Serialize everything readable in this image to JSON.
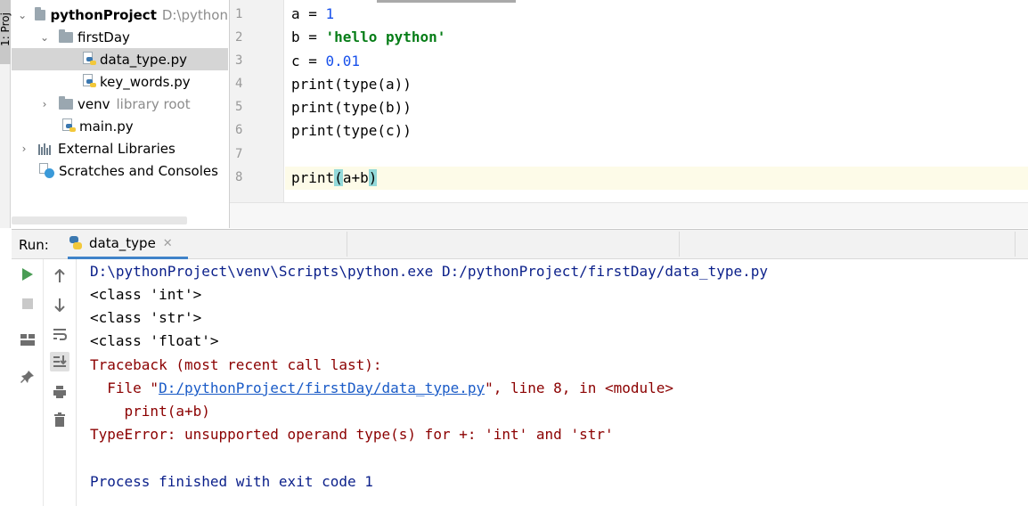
{
  "tool_strip": {
    "project_tab": "1: Proj"
  },
  "project_tree": {
    "root": {
      "name": "pythonProject",
      "path": "D:\\python"
    },
    "items": [
      {
        "label": "firstDay"
      },
      {
        "label": "data_type.py"
      },
      {
        "label": "key_words.py"
      },
      {
        "label": "venv",
        "suffix": "library root"
      },
      {
        "label": "main.py"
      },
      {
        "label": "External Libraries"
      },
      {
        "label": "Scratches and Consoles"
      }
    ]
  },
  "editor": {
    "line_numbers": [
      "1",
      "2",
      "3",
      "4",
      "5",
      "6",
      "7",
      "8"
    ],
    "lines": {
      "l1_var": "a = ",
      "l1_num": "1",
      "l2_var": "b = ",
      "l2_str": "'hello python'",
      "l3_var": "c = ",
      "l3_num": "0.01",
      "l4": "print(type(a))",
      "l5": "print(type(b))",
      "l6": "print(type(c))",
      "l8_a": "print",
      "l8_b": "(",
      "l8_c": "a+b",
      "l8_d": ")"
    }
  },
  "run": {
    "label": "Run:",
    "tab_label": "data_type",
    "console": {
      "cmd": "D:\\pythonProject\\venv\\Scripts\\python.exe D:/pythonProject/firstDay/data_type.py",
      "out1": "<class 'int'>",
      "out2": "<class 'str'>",
      "out3": "<class 'float'>",
      "tb_header": "Traceback (most recent call last):",
      "file_prefix": "  File \"",
      "file_link": "D:/pythonProject/firstDay/data_type.py",
      "file_suffix": "\", line 8, in <module>",
      "code_line": "    print(a+b)",
      "error": "TypeError: unsupported operand type(s) for +: 'int' and 'str'",
      "finished": "Process finished with exit code 1"
    }
  },
  "colors": {
    "selection": "#d5d5d5",
    "run_tab_underline": "#4083c9",
    "console_command": "#0a1f8a",
    "console_error": "#8b0000",
    "link": "#1a5bc7",
    "string": "#067d17",
    "number": "#1750eb",
    "brace_match": "#93d9d9"
  }
}
